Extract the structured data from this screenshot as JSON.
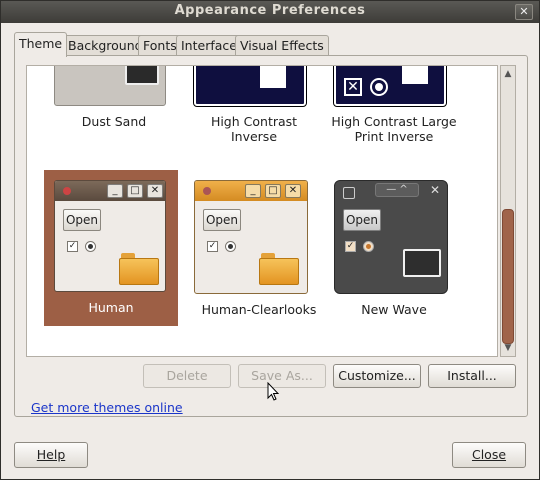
{
  "window": {
    "title": "Appearance Preferences",
    "close_glyph": "✕"
  },
  "tabs": [
    {
      "label": "Theme",
      "active": true
    },
    {
      "label": "Background",
      "active": false
    },
    {
      "label": "Fonts",
      "active": false
    },
    {
      "label": "Interface",
      "active": false
    },
    {
      "label": "Visual Effects",
      "active": false
    }
  ],
  "themes": {
    "row1": [
      {
        "label": "Dust Sand"
      },
      {
        "label": "High Contrast Inverse"
      },
      {
        "label": "High Contrast Large Print Inverse"
      }
    ],
    "row2": [
      {
        "label": "Human",
        "selected": true,
        "open_label": "Open"
      },
      {
        "label": "Human-Clearlooks",
        "selected": false,
        "open_label": "Open"
      },
      {
        "label": "New Wave",
        "selected": false,
        "open_label": "Open"
      }
    ]
  },
  "actions": {
    "delete": "Delete",
    "save_as": "Save As...",
    "customize": "Customize...",
    "install": "Install..."
  },
  "link": {
    "more_themes": "Get more themes online"
  },
  "footer": {
    "help": "Help",
    "close": "Close"
  },
  "colors": {
    "selection": "#9d5f45",
    "human_bar": "#6b5a4c",
    "clearlooks_bar": "#e29b2e",
    "newwave_bg": "#4a4a4a",
    "high_contrast": "#0f0f3f",
    "link": "#1a35c9"
  }
}
